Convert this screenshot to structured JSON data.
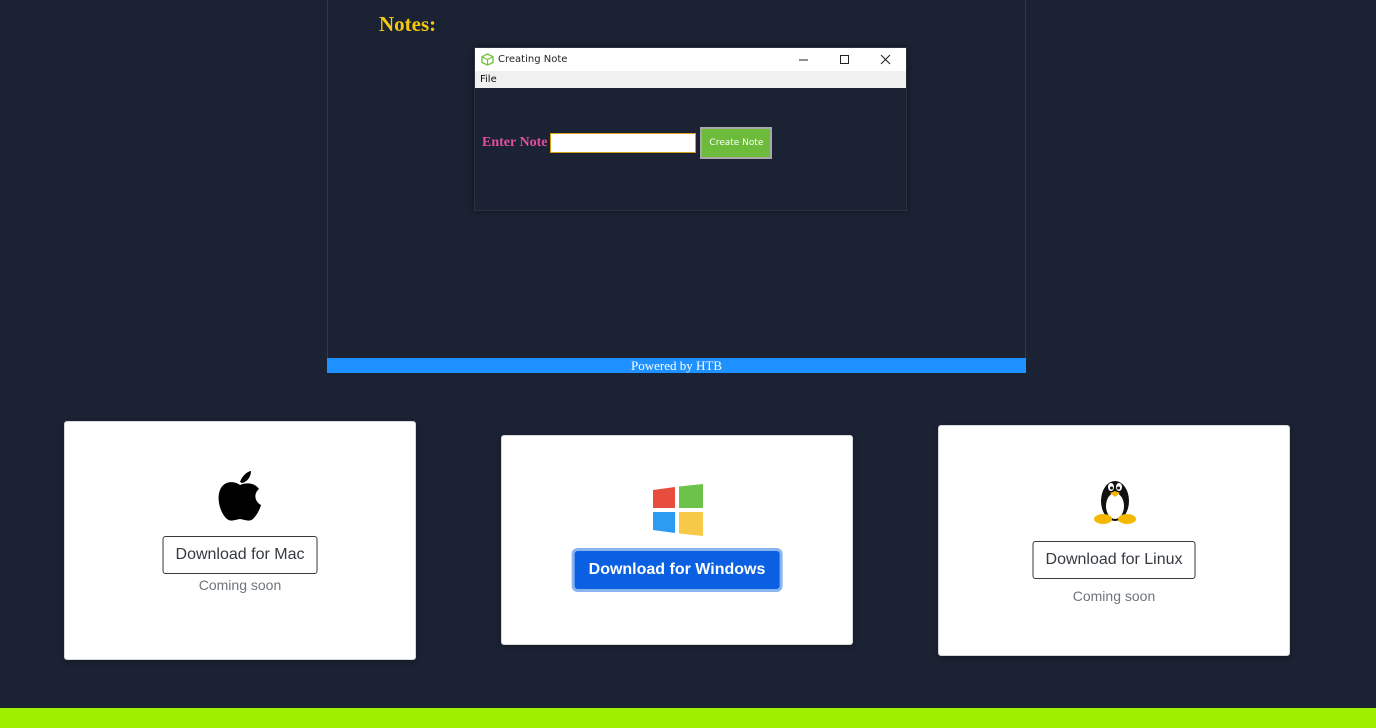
{
  "preview": {
    "heading": "Notes:",
    "window": {
      "title": "Creating Note",
      "menu": [
        "File"
      ],
      "label": "Enter Note",
      "input_value": "",
      "button_label": "Create Note"
    },
    "footer_text": "Powered by HTB"
  },
  "downloads": [
    {
      "icon": "apple-icon",
      "button": "Download for Mac",
      "note": "Coming soon"
    },
    {
      "icon": "windows-icon",
      "button": "Download for Windows",
      "note": ""
    },
    {
      "icon": "linux-penguin-icon",
      "button": "Download for Linux",
      "note": "Coming soon"
    }
  ],
  "colors": {
    "background": "#1b2233",
    "accent_green": "#9fef00",
    "htb_blue": "#1e90ff",
    "notes_gold": "#f2c811",
    "label_pink": "#e0509f",
    "primary_button": "#0a60e0"
  }
}
